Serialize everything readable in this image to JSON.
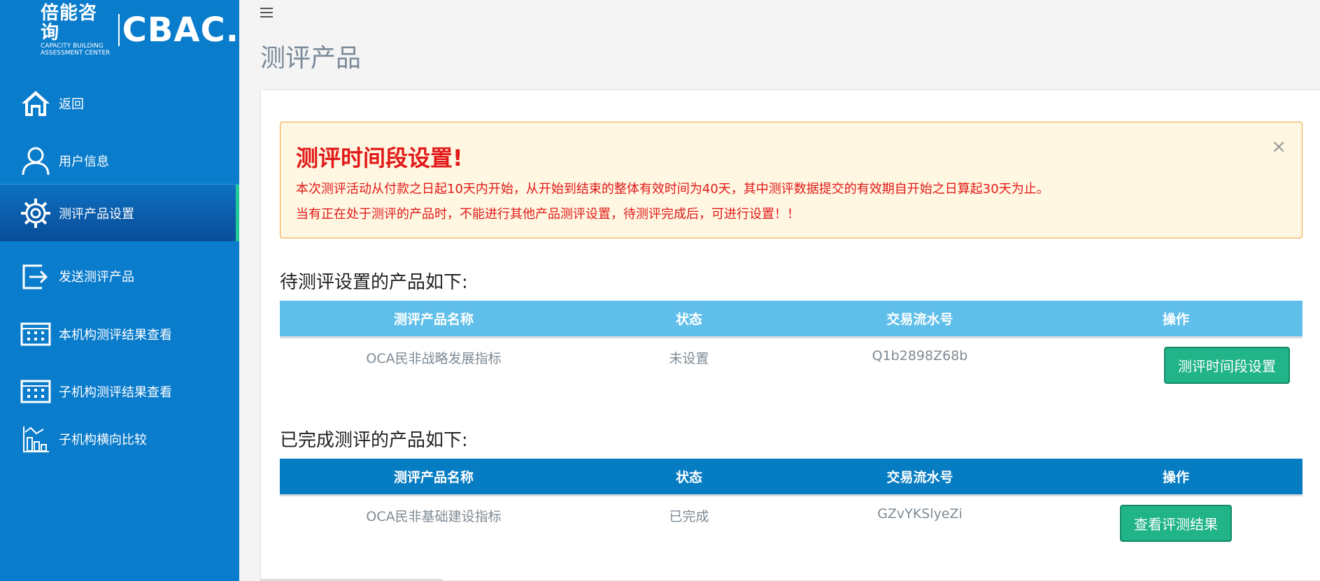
{
  "brand": {
    "cn_name": "倍能咨询",
    "en_small_1": "CAPACITY  BUILDING",
    "en_small_2": "ASSESSMENT CENTER",
    "en_logo": "CBAC."
  },
  "sidebar": {
    "items": [
      {
        "label": "返回",
        "icon": "home-icon"
      },
      {
        "label": "用户信息",
        "icon": "user-icon"
      },
      {
        "label": "测评产品设置",
        "icon": "gear-icon",
        "active": true
      },
      {
        "label": "发送测评产品",
        "icon": "send-icon"
      },
      {
        "label": "本机构测评结果查看",
        "icon": "calendar-grid-icon"
      },
      {
        "label": "子机构测评结果查看",
        "icon": "calendar-grid-icon"
      },
      {
        "label": "子机构横向比较",
        "icon": "bar-chart-icon"
      }
    ]
  },
  "header": {
    "title": "测评产品"
  },
  "alert": {
    "title": "测评时间段设置!",
    "line1": "本次测评活动从付款之日起10天内开始，从开始到结束的整体有效时间为40天，其中测评数据提交的有效期自开始之日算起30天为止。",
    "line2": "当有正在处于测评的产品时，不能进行其他产品测评设置，待测评完成后，可进行设置！！",
    "close": "×"
  },
  "pending": {
    "heading": "待测评设置的产品如下:",
    "columns": [
      "测评产品名称",
      "状态",
      "交易流水号",
      "操作"
    ],
    "rows": [
      {
        "name": "OCA民非战略发展指标",
        "status": "未设置",
        "txn": "Q1b2898Z68b",
        "action": "测评时间段设置"
      }
    ]
  },
  "completed": {
    "heading": "已完成测评的产品如下:",
    "columns": [
      "测评产品名称",
      "状态",
      "交易流水号",
      "操作"
    ],
    "rows": [
      {
        "name": "OCA民非基础建设指标",
        "status": "已完成",
        "txn": "GZvYKSlyeZi",
        "action": "查看评测结果"
      }
    ]
  },
  "colors": {
    "sidebar_bg": "#0a7ccc",
    "active_accent": "#22c79a",
    "alert_text": "#e11919",
    "alert_bg": "#fff7e1",
    "table_head_light": "#5fbfea",
    "table_head_dark": "#067cc3",
    "button_green": "#20b488"
  }
}
